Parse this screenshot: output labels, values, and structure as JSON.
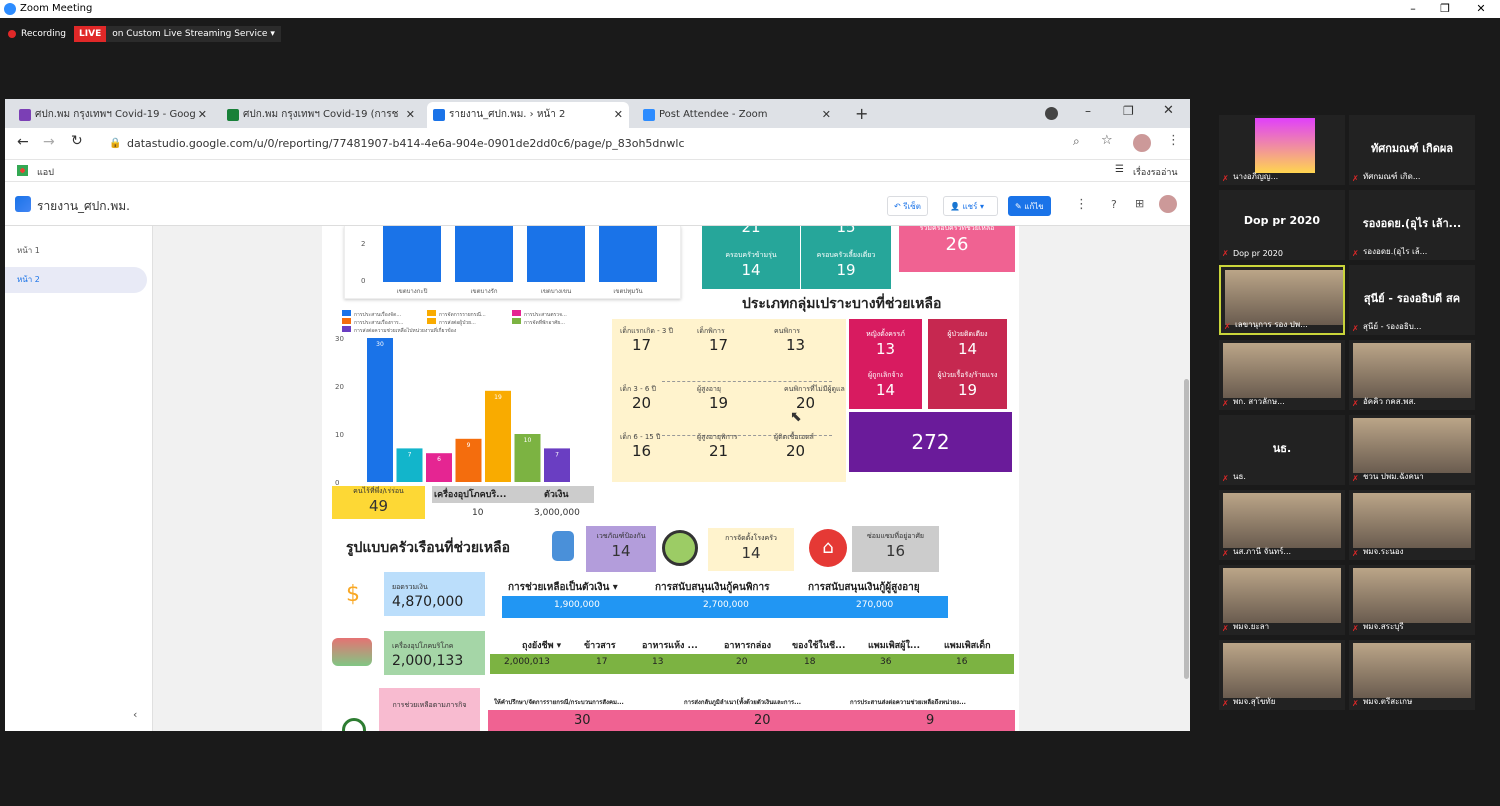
{
  "zoom": {
    "title": "Zoom Meeting",
    "recording": "Recording",
    "live": "LIVE",
    "stream": "on Custom Live Streaming Service"
  },
  "browser": {
    "tabs": [
      {
        "label": "ศปก.พม กรุงเทพฯ Covid-19 - Goog",
        "color": "#7b3fb5"
      },
      {
        "label": "ศปก.พม กรุงเทพฯ Covid-19 (การช",
        "color": "#188038"
      },
      {
        "label": "รายงาน_ศปก.พม. › หน้า 2",
        "color": "#1a73e8"
      },
      {
        "label": "Post Attendee - Zoom",
        "color": "#2d8cff"
      }
    ],
    "url": "datastudio.google.com/u/0/reporting/77481907-b414-4e6a-904e-0901de2dd0c6/page/p_83oh5dnwlc",
    "apps": "แอป",
    "reading_list": "เรื่องรออ่าน"
  },
  "ds": {
    "title": "รายงาน_ศปก.พม.",
    "reset": "รีเซ็ต",
    "share": "แชร์",
    "edit": "แก้ไข",
    "pages": [
      "หน้า 1",
      "หน้า 2"
    ]
  },
  "chart_top": {
    "y_ticks": [
      "2",
      "0"
    ],
    "categories": [
      "เขตบางกะปิ",
      "เขตบางรัก",
      "เขตบางเขน",
      "เขตปทุมวัน"
    ]
  },
  "chart_data": {
    "type": "bar",
    "categories": [
      "การประสานเรื่องจัด...",
      "การประสานเรื่องการ...",
      "การจัดการรายกรณี...",
      "การส่งต่อความช่วยเหลือ...",
      "การประสานตรวจ...",
      "การจัดที่พักอาศัย...",
      "การส่งต่อความช่วยเหลือ"
    ],
    "series": [
      {
        "values": [
          30,
          7,
          6,
          9,
          19,
          10,
          7
        ],
        "colors": [
          "#1a73e8",
          "#12b5cb",
          "#e52592",
          "#f46d0d",
          "#f9ab00",
          "#7cb342",
          "#6a3ec2"
        ]
      }
    ],
    "ylim": [
      0,
      30
    ],
    "y_ticks": [
      "30",
      "20",
      "10",
      "0"
    ],
    "legend": [
      "การประสานเรื่องจัด...",
      "การจัดการรายกรณี...",
      "การประสานตรวจ...",
      "การประสานเรื่องการ...",
      "การส่งต่อผู้ป่วย...",
      "การจัดที่พักอาศัย...",
      "การส่งต่อความช่วยเหลือไปหน่วยงานที่เกี่ยวข้อง"
    ]
  },
  "top_cards": {
    "t1": "21",
    "t2": "15",
    "elder_family_label": "ครอบครัวข้ามรุ่น",
    "elder_family_val": "14",
    "single_family_label": "ครอบครัวเลี้ยงเดี่ยว",
    "single_family_val": "19",
    "total_label": "รวมครอบครัวที่ช่วยเหลือ",
    "total_val": "26"
  },
  "vulnerable": {
    "title": "ประเภทกลุ่มเปราะบางที่ช่วยเหลือ",
    "cells": [
      {
        "label": "เด็กแรกเกิด - 3 ปี",
        "val": "17"
      },
      {
        "label": "เด็กพิการ",
        "val": "17"
      },
      {
        "label": "คนพิการ",
        "val": "13"
      },
      {
        "label": "เด็ก 3 - 6 ปี",
        "val": "20"
      },
      {
        "label": "ผู้สูงอายุ",
        "val": "19"
      },
      {
        "label": "คนพิการที่ไม่มีผู้ดูแล",
        "val": "20"
      },
      {
        "label": "เด็ก 6 - 15 ปี",
        "val": "16"
      },
      {
        "label": "ผู้สูงอายุพิการ",
        "val": "21"
      },
      {
        "label": "ผู้ติดเชื้อเอดส์",
        "val": "20"
      }
    ],
    "pink": [
      {
        "label": "หญิงตั้งครรภ์",
        "val": "13"
      },
      {
        "label": "ผู้ป่วยติดเตียง",
        "val": "14"
      },
      {
        "label": "ผู้ถูกเลิกจ้าง",
        "val": "14"
      },
      {
        "label": "ผู้ป่วยเรื้อรัง/ร้ายแรง",
        "val": "19"
      }
    ],
    "total": "272"
  },
  "mid": {
    "homeless_label": "คนไร้ที่พึ่ง/เร่ร่อน",
    "homeless_val": "49",
    "consumer_label": "เครื่องอุปโภคบริ...",
    "consumer_val": "10",
    "cash_label": "ตัวเงิน",
    "cash_val": "3,000,000"
  },
  "household": {
    "title": "รูปแบบครัวเรือนที่ช่วยเหลือ",
    "c1_label": "เวชภัณฑ์ป้องกัน",
    "c1_val": "14",
    "c2_label": "การจัดตั้งโรงครัว",
    "c2_val": "14",
    "c3_label": "ซ่อมแซมที่อยู่อาศัย",
    "c3_val": "16"
  },
  "money": {
    "label": "ยอดรวมเงิน",
    "val": "4,870,000",
    "headers": [
      "การช่วยเหลือเป็นตัวเงิน ▾",
      "การสนับสนุนเงินกู้คนพิการ",
      "การสนับสนุนเงินกู้ผู้สูงอายุ"
    ],
    "values": [
      "1,900,000",
      "2,700,000",
      "270,000"
    ]
  },
  "goods": {
    "label": "เครื่องอุปโภคบริโภค",
    "val": "2,000,133",
    "headers": [
      "ถุงยังชีพ ▾",
      "ข้าวสาร",
      "อาหารแห้ง ...",
      "อาหารกล่อง",
      "ของใช้ในชี...",
      "แพมเพิสผู้ใ...",
      "แพมเพิสเด็ก"
    ],
    "values": [
      "2,000,013",
      "17",
      "13",
      "20",
      "18",
      "36",
      "16"
    ]
  },
  "mission": {
    "label": "การช่วยเหลือตามภารกิจ",
    "headers": [
      "ให้คำปรึกษา/จัดการรายกรณี/กระบวนการสังคม...",
      "การส่งกลับภูมิลำเนา(ทั้งด้วยตัวเงินและการ...",
      "การประสานส่งต่อความช่วยเหลือถึงหน่วยง..."
    ],
    "values": [
      "30",
      "20",
      "9"
    ]
  },
  "participants": [
    {
      "name": "นางอภิญญ...",
      "kind": "photo"
    },
    {
      "name": "ทัศกมณฑ์ เกิด...",
      "kind": "text",
      "display": "ทัศกมณฑ์ เกิดผล"
    },
    {
      "name": "Dop pr 2020",
      "kind": "text",
      "display": "Dop pr 2020"
    },
    {
      "name": "รองอดย.(อุไร เล้...",
      "kind": "text",
      "display": "รองอดย.(อุไร เล้า..."
    },
    {
      "name": "เลขานุการ รอง ปพ...",
      "kind": "photo"
    },
    {
      "name": "สุนีย์ - รองอธิบ...",
      "kind": "text",
      "display": "สุนีย์ - รองอธิบดี สค"
    },
    {
      "name": "พก. สาวลักษ...",
      "kind": "photo"
    },
    {
      "name": "อัคคิว กคส.พส.",
      "kind": "photo"
    },
    {
      "name": "นธ.",
      "kind": "text",
      "display": "นธ."
    },
    {
      "name": "ชวน ปพม.ฉังคนา",
      "kind": "photo"
    },
    {
      "name": "นส.ภานี จันทร์...",
      "kind": "photo"
    },
    {
      "name": "พมจ.ระนอง",
      "kind": "photo"
    },
    {
      "name": "พมจ.ยะลา",
      "kind": "photo"
    },
    {
      "name": "พมจ.สระบุรี",
      "kind": "photo"
    },
    {
      "name": "พมจ.สุโขทัย",
      "kind": "photo"
    },
    {
      "name": "พมจ.ตรีสะเกษ",
      "kind": "photo"
    }
  ]
}
